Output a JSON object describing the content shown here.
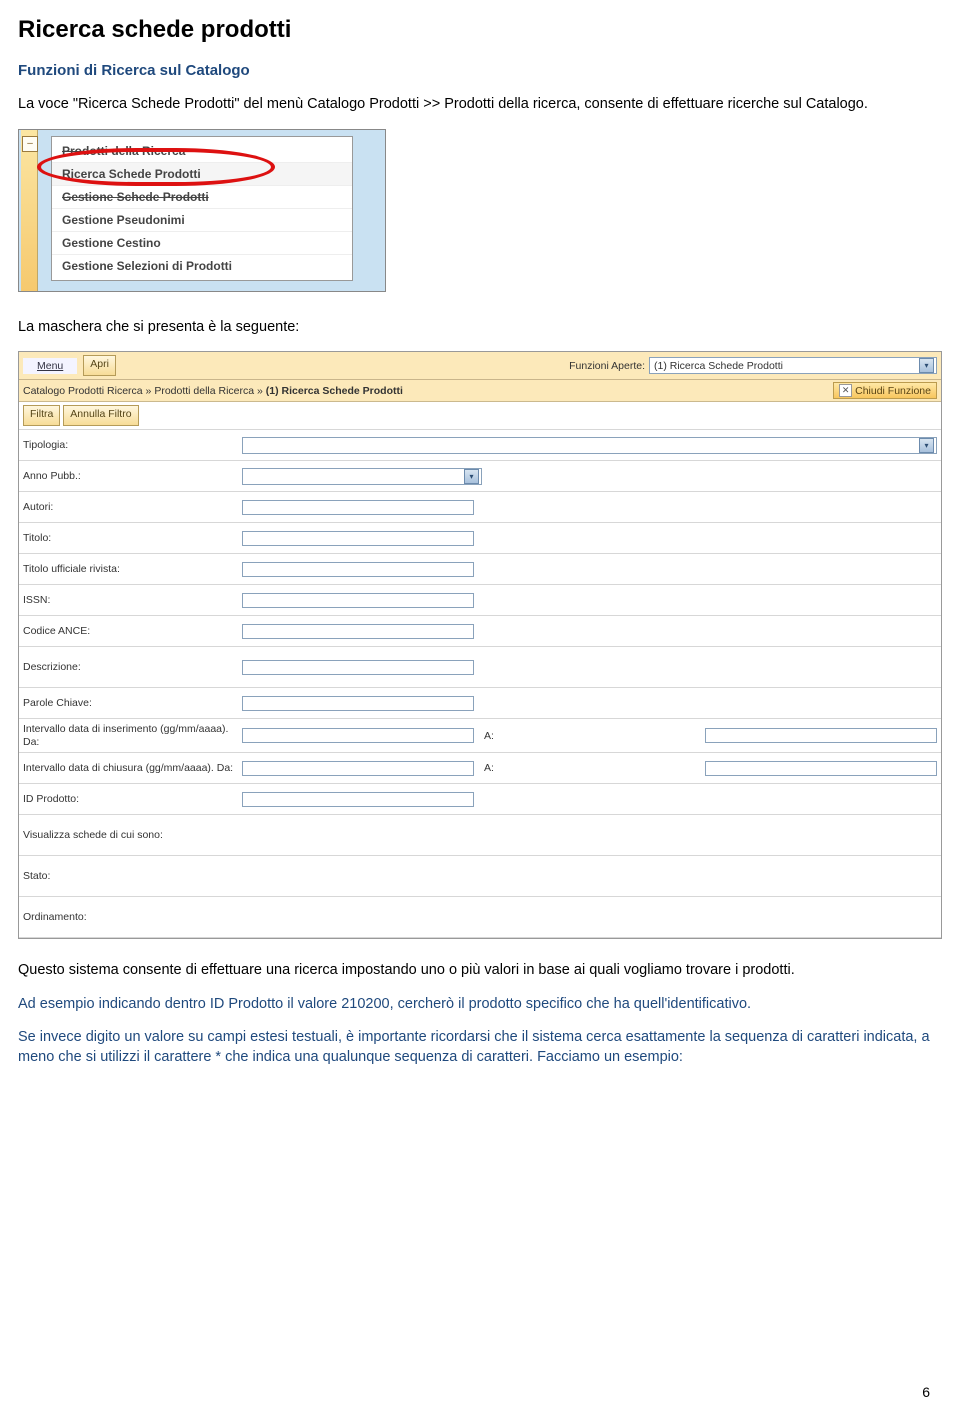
{
  "h1": "Ricerca schede prodotti",
  "h2": "Funzioni di Ricerca sul Catalogo",
  "p1": "La voce \"Ricerca Schede Prodotti\" del menù Catalogo Prodotti >> Prodotti della ricerca, consente di effettuare ricerche sul Catalogo.",
  "menu": {
    "items": [
      "Prodotti della Ricerca",
      "Ricerca Schede Prodotti",
      "Gestione Schede Prodotti",
      "Gestione Pseudonimi",
      "Gestione Cestino",
      "Gestione Selezioni di Prodotti"
    ]
  },
  "p2": "La maschera che si presenta è la seguente:",
  "form": {
    "menu_btn": "Menu",
    "apri_btn": "Apri",
    "funzioni_label": "Funzioni Aperte:",
    "funzioni_value": "(1) Ricerca Schede Prodotti",
    "breadcrumb_prefix": "Catalogo Prodotti Ricerca » Prodotti della Ricerca » ",
    "breadcrumb_bold": "(1) Ricerca Schede Prodotti",
    "chiudi": "Chiudi Funzione",
    "filtra": "Filtra",
    "annulla": "Annulla Filtro",
    "labels": {
      "tipologia": "Tipologia:",
      "anno": "Anno Pubb.:",
      "autori": "Autori:",
      "titolo": "Titolo:",
      "rivista": "Titolo ufficiale rivista:",
      "issn": "ISSN:",
      "ance": "Codice ANCE:",
      "descrizione": "Descrizione:",
      "parole": "Parole Chiave:",
      "intervallo_ins": "Intervallo data di inserimento (gg/mm/aaaa). Da:",
      "intervallo_chi": "Intervallo data di chiusura (gg/mm/aaaa). Da:",
      "a": "A:",
      "idprod": "ID Prodotto:",
      "visualizza": "Visualizza schede di cui sono:",
      "stato": "Stato:",
      "ordinamento": "Ordinamento:"
    }
  },
  "p3": "Questo sistema consente di effettuare una ricerca impostando uno o più  valori in base ai quali vogliamo trovare i prodotti.",
  "p4": "Ad esempio indicando dentro ID Prodotto il valore 210200, cercherò il prodotto specifico che ha quell'identificativo.",
  "p5": "Se invece digito un valore su campi estesi testuali, è importante ricordarsi che il sistema cerca esattamente la sequenza di caratteri indicata, a meno che si utilizzi il carattere * che indica una qualunque sequenza di caratteri. Facciamo un esempio:",
  "pagenum": "6"
}
